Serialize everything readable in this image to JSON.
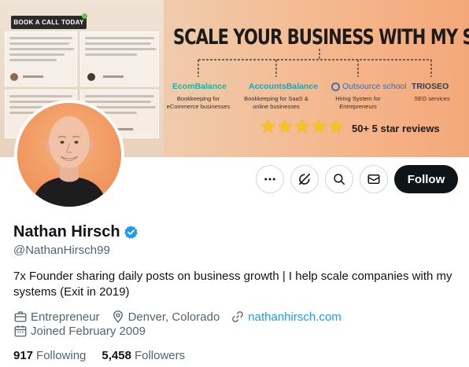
{
  "banner": {
    "cta_label": "BOOK A CALL TODAY",
    "headline": "SCALE YOUR BUSINESS WITH MY SYSTEMS",
    "brands": [
      {
        "name": "EcomBalance",
        "color": "#17b3a8",
        "sub": "Bookkeeping for eCommerce businesses"
      },
      {
        "name": "AccountsBalance",
        "color": "#1fa3b5",
        "sub": "Bookkeeping for SaaS & online businesses"
      },
      {
        "name": "Outsource school",
        "color": "#2f6fb6",
        "sub": "Hiring System for Entrepreneurs"
      },
      {
        "name": "TRIOSEO",
        "color": "#3b3b4a",
        "sub": "SEO services"
      }
    ],
    "stars": "★★★★★",
    "reviews": "50+ 5 star reviews"
  },
  "actions": {
    "more_icon": "more-icon",
    "grok_icon": "grok-icon",
    "search_icon": "search-icon",
    "message_icon": "message-icon",
    "follow_label": "Follow"
  },
  "profile": {
    "name": "Nathan Hirsch",
    "handle": "@NathanHirsch99",
    "bio": "7x Founder sharing daily posts on business growth | I help scale companies with my systems (Exit in 2019)",
    "category": "Entrepreneur",
    "location": "Denver, Colorado",
    "website": "nathanhirsch.com",
    "joined": "Joined February 2009",
    "following_count": "917",
    "following_label": "Following",
    "followers_count": "5,458",
    "followers_label": "Followers"
  },
  "colors": {
    "accent": "#1d9bf0",
    "follow_bg": "#0f1419",
    "muted_text": "#536471"
  }
}
